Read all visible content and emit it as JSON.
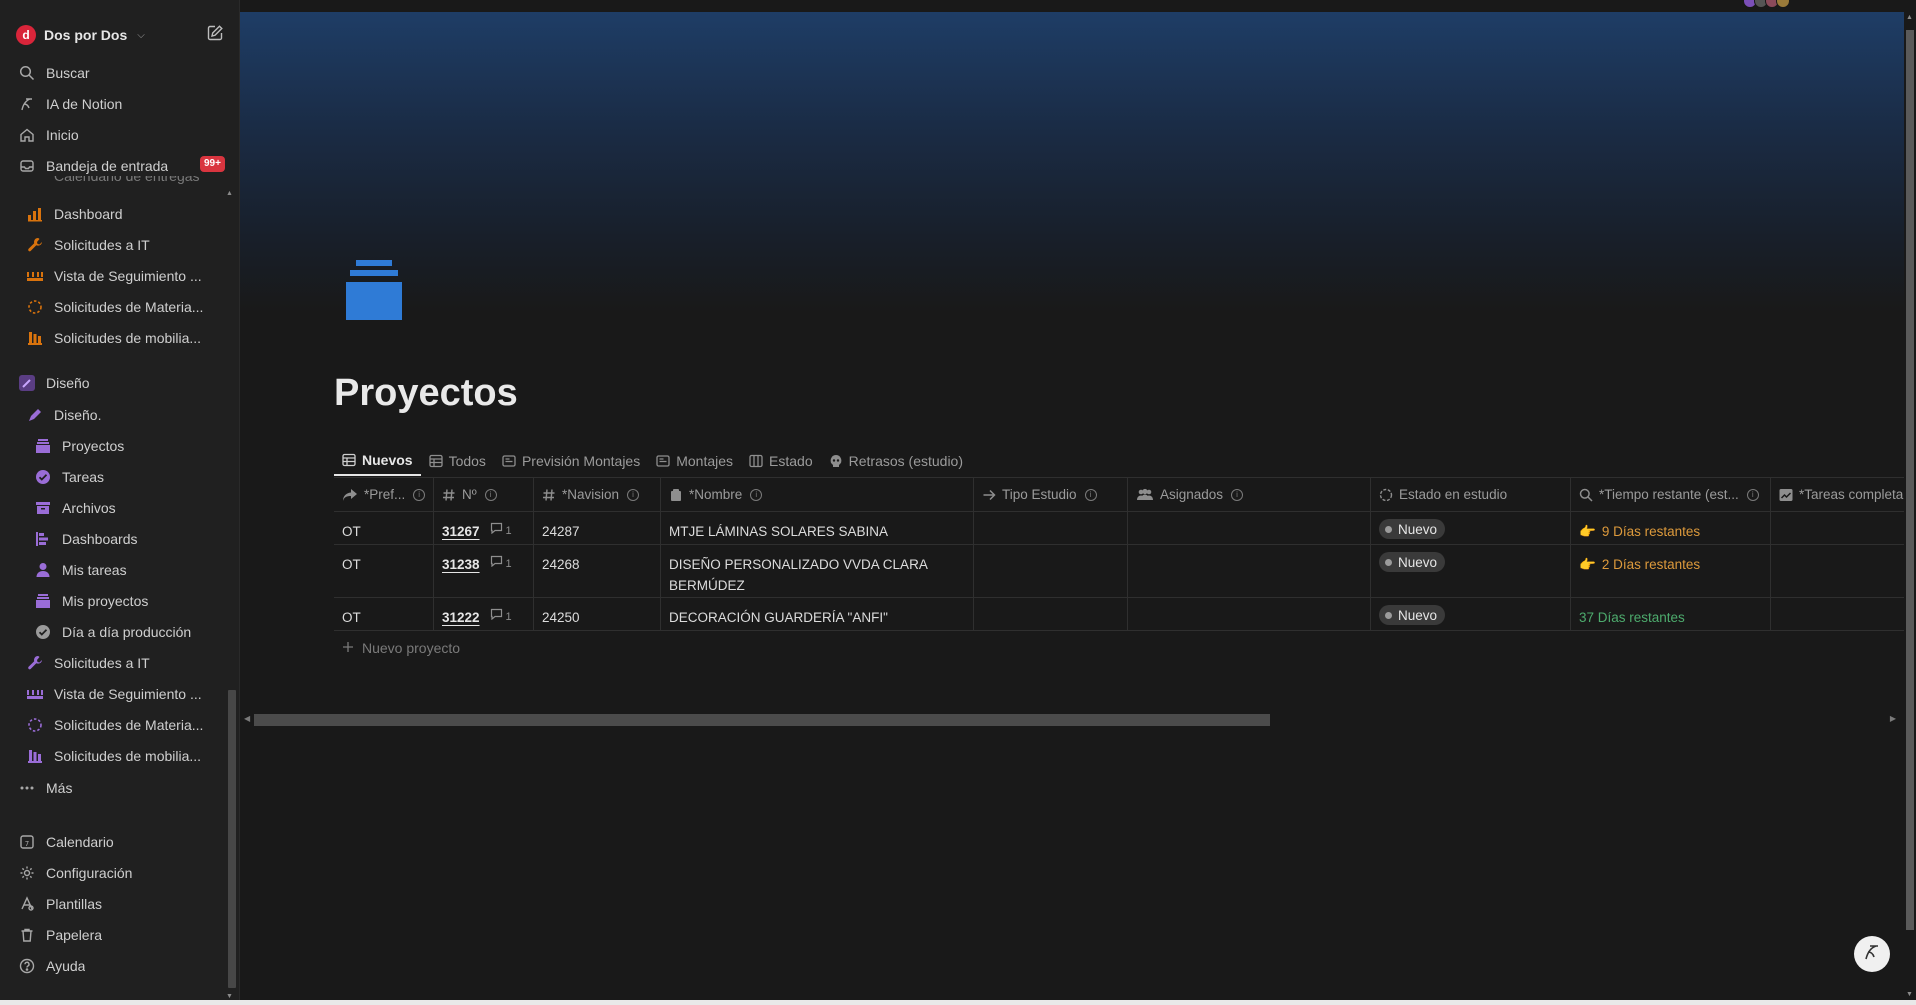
{
  "workspace": {
    "name": "Dos por Dos",
    "logo_letter": "d"
  },
  "sidebar": {
    "top": [
      {
        "label": "Buscar",
        "icon": "search-icon"
      },
      {
        "label": "IA de Notion",
        "icon": "notion-ai-icon"
      },
      {
        "label": "Inicio",
        "icon": "home-icon"
      },
      {
        "label": "Bandeja de entrada",
        "icon": "inbox-icon",
        "badge": "99+"
      }
    ],
    "clipped_label": "Calendario de entregas",
    "group1": [
      {
        "label": "Dashboard",
        "icon": "dashboard-icon"
      },
      {
        "label": "Solicitudes a IT",
        "icon": "wrench-icon"
      },
      {
        "label": "Vista de Seguimiento ...",
        "icon": "timeline-icon"
      },
      {
        "label": "Solicitudes de Materia...",
        "icon": "dashed-circle-icon"
      },
      {
        "label": "Solicitudes de mobilia...",
        "icon": "furniture-icon"
      }
    ],
    "section": {
      "label": "Diseño",
      "icon": "pencil-icon"
    },
    "design_root": {
      "label": "Diseño.",
      "icon": "pencil-icon"
    },
    "design_children": [
      {
        "label": "Proyectos",
        "icon": "stack-icon"
      },
      {
        "label": "Tareas",
        "icon": "check-circle-icon"
      },
      {
        "label": "Archivos",
        "icon": "archive-icon"
      },
      {
        "label": "Dashboards",
        "icon": "dashboard-bars-icon"
      },
      {
        "label": "Mis tareas",
        "icon": "person-icon"
      },
      {
        "label": "Mis proyectos",
        "icon": "stack-icon"
      },
      {
        "label": "Día a día producción",
        "icon": "check-circle-icon"
      }
    ],
    "design_after": [
      {
        "label": "Solicitudes a IT",
        "icon": "wrench-icon"
      },
      {
        "label": "Vista de Seguimiento ...",
        "icon": "timeline-icon"
      },
      {
        "label": "Solicitudes de Materia...",
        "icon": "dashed-circle-icon"
      },
      {
        "label": "Solicitudes de mobilia...",
        "icon": "furniture-icon"
      }
    ],
    "more": {
      "label": "Más",
      "icon": "more-icon"
    },
    "bottom": [
      {
        "label": "Calendario",
        "icon": "calendar-icon"
      },
      {
        "label": "Configuración",
        "icon": "gear-icon"
      },
      {
        "label": "Plantillas",
        "icon": "templates-icon"
      },
      {
        "label": "Papelera",
        "icon": "trash-icon"
      },
      {
        "label": "Ayuda",
        "icon": "help-icon"
      }
    ]
  },
  "page": {
    "title": "Proyectos",
    "icon": "stack-icon",
    "icon_color": "#2f7bd6"
  },
  "tabs": [
    {
      "label": "Nuevos",
      "icon": "table-icon",
      "active": true
    },
    {
      "label": "Todos",
      "icon": "table-icon"
    },
    {
      "label": "Previsión Montajes",
      "icon": "gallery-icon"
    },
    {
      "label": "Montajes",
      "icon": "gallery-icon"
    },
    {
      "label": "Estado",
      "icon": "board-icon"
    },
    {
      "label": "Retrasos (estudio)",
      "icon": "skull-icon"
    }
  ],
  "table": {
    "columns": [
      {
        "label": "*Pref...",
        "icon": "relation-arrow-icon",
        "info": true
      },
      {
        "label": "Nº",
        "icon": "hash-icon",
        "info": true
      },
      {
        "label": "*Navision",
        "icon": "hash-icon",
        "info": true
      },
      {
        "label": "*Nombre",
        "icon": "title-icon",
        "info": true
      },
      {
        "label": "Tipo Estudio",
        "icon": "relation-arrow-icon",
        "info": true
      },
      {
        "label": "Asignados",
        "icon": "people-icon",
        "info": true
      },
      {
        "label": "Estado en estudio",
        "icon": "status-icon",
        "info": false
      },
      {
        "label": "*Tiempo restante (est...",
        "icon": "search-icon",
        "info": true
      },
      {
        "label": "*Tareas completa",
        "icon": "chart-icon",
        "info": false
      }
    ],
    "rows": [
      {
        "pref": "OT",
        "num": "31267",
        "comments": "1",
        "navision": "24287",
        "nombre": "MTJE LÁMINAS SOLARES SABINA BOULEVARD",
        "tipo": "",
        "asignados": "",
        "estado": "Nuevo",
        "tiempo": "9 Días restantes",
        "tiempo_icon": "pointing-hand-icon",
        "tiempo_color": "#dd9a3c"
      },
      {
        "pref": "OT",
        "num": "31238",
        "comments": "1",
        "navision": "24268",
        "nombre": "DISEÑO PERSONALIZADO VVDA CLARA BERMÚDEZ",
        "tipo": "",
        "asignados": "",
        "estado": "Nuevo",
        "tiempo": "2 Días restantes",
        "tiempo_icon": "pointing-hand-icon",
        "tiempo_color": "#dd9a3c"
      },
      {
        "pref": "OT",
        "num": "31222",
        "comments": "1",
        "navision": "24250",
        "nombre": "DECORACIÓN GUARDERÍA \"ANFI\"",
        "tipo": "",
        "asignados": "",
        "estado": "Nuevo",
        "tiempo": "37 Días restantes",
        "tiempo_icon": "",
        "tiempo_color": "#4dab6d"
      }
    ],
    "add_label": "Nuevo proyecto"
  },
  "colors": {
    "background": "#191919",
    "sidebar": "#202020",
    "purple_icons": "#9a6dd7",
    "orange_icons": "#d9730d",
    "badge": "#d9353f"
  }
}
